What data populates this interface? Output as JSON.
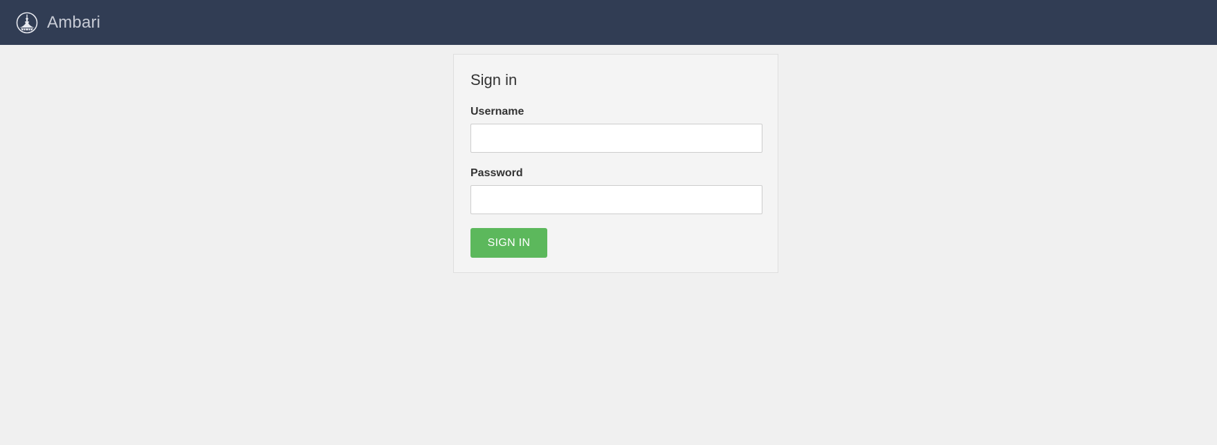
{
  "header": {
    "logo_icon": "ambari-logo-icon",
    "app_name": "Ambari",
    "background_color": "#313d54"
  },
  "login": {
    "title": "Sign in",
    "username_label": "Username",
    "username_value": "",
    "password_label": "Password",
    "password_value": "",
    "submit_label": "SIGN IN",
    "submit_color": "#5cb85c"
  }
}
